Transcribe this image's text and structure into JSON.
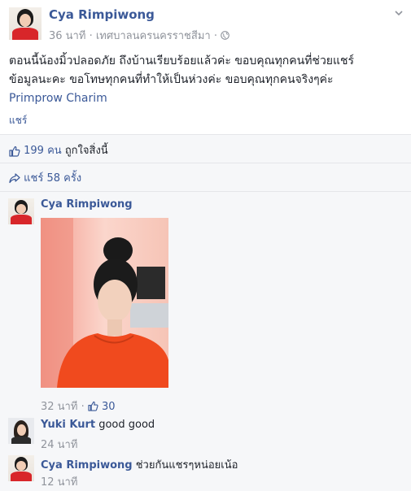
{
  "post": {
    "author": "Cya Rimpiwong",
    "time": "36 นาที",
    "location": "เทศบาลนครนครราชสีมา",
    "separator": "·",
    "text_line1": "ตอนนี้น้องมิ้วปลอดภัย ถึงบ้านเรียบร้อยแล้วค่ะ ขอบคุณทุกคนที่ช่วยแชร์",
    "text_line2": "ข้อมูลนะคะ ขอโทษทุกคนที่ทำให้เป็นห่วงค่ะ ขอบคุณทุกคนจริงๆค่ะ",
    "tagged": "Primprow Charim",
    "share_link": "แชร์"
  },
  "likes": {
    "count": "199 คน",
    "label": "ถูกใจสิ่งนี้"
  },
  "shares": {
    "label": "แชร์ 58 ครั้ง"
  },
  "comments": [
    {
      "author": "Cya Rimpiwong",
      "text": "",
      "time": "32 นาที",
      "likes": "30"
    },
    {
      "author": "Yuki Kurt",
      "text": "good good",
      "time": "24 นาที"
    },
    {
      "author": "Cya Rimpiwong",
      "text": "ช่วยกันแชรๆหน่อยเน้อ",
      "time": "12 นาที"
    }
  ],
  "colors": {
    "link": "#3b5998",
    "meta": "#90949c",
    "bg": "#f6f7f9"
  },
  "icons": [
    "chevron-down-icon",
    "globe-icon",
    "thumbs-up-icon",
    "share-arrow-icon"
  ]
}
